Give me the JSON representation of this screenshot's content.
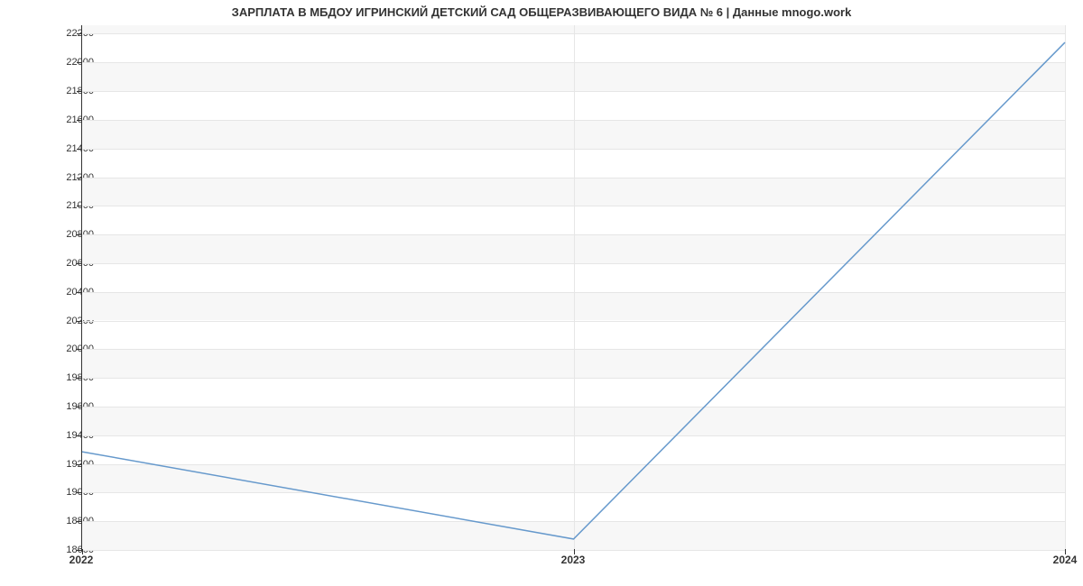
{
  "chart_data": {
    "type": "line",
    "title": "ЗАРПЛАТА В МБДОУ ИГРИНСКИЙ ДЕТСКИЙ САД ОБЩЕРАЗВИВАЮЩЕГО ВИДА № 6 | Данные mnogo.work",
    "x": [
      2022,
      2023,
      2024
    ],
    "values": [
      19280,
      18670,
      22140
    ],
    "xticks": [
      2022,
      2023,
      2024
    ],
    "yticks": [
      18600,
      18800,
      19000,
      19200,
      19400,
      19600,
      19800,
      20000,
      20200,
      20400,
      20600,
      20800,
      21000,
      21200,
      21400,
      21600,
      21800,
      22000,
      22200
    ],
    "xlim": [
      2022,
      2024
    ],
    "ylim": [
      18600,
      22260
    ],
    "series_color": "#6699cc",
    "xlabel": "",
    "ylabel": ""
  }
}
